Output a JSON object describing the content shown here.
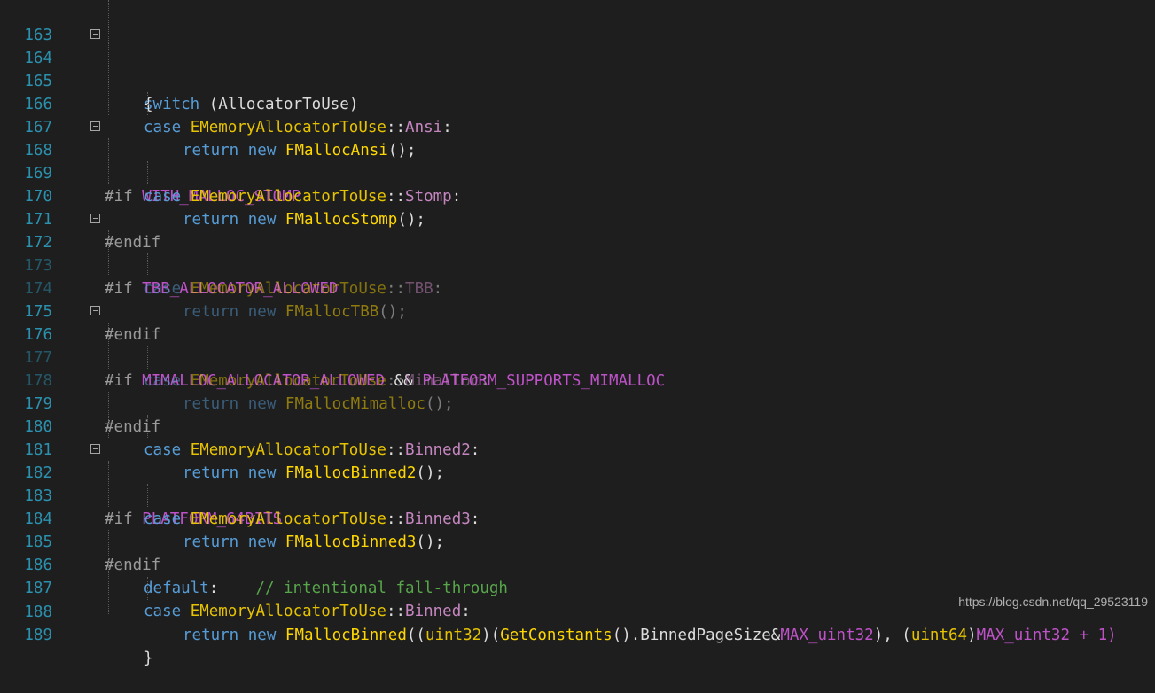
{
  "colors": {
    "background": "#1e1e1e",
    "line_number": "#2b91af",
    "keyword": "#569cd6",
    "class_name": "#e6c300",
    "enum_member": "#c586c0",
    "function": "#ffd700",
    "preprocessor": "#9b9b9b",
    "macro": "#be52c8",
    "comment": "#57a64a"
  },
  "lines": [
    {
      "n": "163",
      "tokens": []
    },
    {
      "n": "164",
      "tokens": [
        {
          "t": "switch",
          "c": "kw"
        },
        {
          "t": " (",
          "c": "plain"
        },
        {
          "t": "AllocatorToUse",
          "c": "plain"
        },
        {
          "t": ")",
          "c": "plain"
        }
      ]
    },
    {
      "n": "165",
      "tokens": [
        {
          "t": "{",
          "c": "plain"
        }
      ]
    },
    {
      "n": "166",
      "tokens": [
        {
          "t": "case ",
          "c": "kw"
        },
        {
          "t": "EMemoryAllocatorToUse",
          "c": "cls"
        },
        {
          "t": "::",
          "c": "plain"
        },
        {
          "t": "Ansi",
          "c": "enum"
        },
        {
          "t": ":",
          "c": "plain"
        }
      ]
    },
    {
      "n": "167",
      "tokens": [
        {
          "t": "return new ",
          "c": "kw"
        },
        {
          "t": "FMallocAnsi",
          "c": "fn"
        },
        {
          "t": "();",
          "c": "plain"
        }
      ]
    },
    {
      "n": "168",
      "tokens": [
        {
          "t": "#if ",
          "c": "pp"
        },
        {
          "t": "WITH_MALLOC_STOMP",
          "c": "macro"
        }
      ]
    },
    {
      "n": "169",
      "tokens": [
        {
          "t": "case ",
          "c": "kw"
        },
        {
          "t": "EMemoryAllocatorToUse",
          "c": "cls"
        },
        {
          "t": "::",
          "c": "plain"
        },
        {
          "t": "Stomp",
          "c": "enum"
        },
        {
          "t": ":",
          "c": "plain"
        }
      ]
    },
    {
      "n": "170",
      "tokens": [
        {
          "t": "return new ",
          "c": "kw"
        },
        {
          "t": "FMallocStomp",
          "c": "fn"
        },
        {
          "t": "();",
          "c": "plain"
        }
      ]
    },
    {
      "n": "171",
      "tokens": [
        {
          "t": "#endif",
          "c": "pp"
        }
      ]
    },
    {
      "n": "172",
      "tokens": [
        {
          "t": "#if ",
          "c": "pp"
        },
        {
          "t": "TBB_ALLOCATOR_ALLOWED",
          "c": "macro"
        }
      ]
    },
    {
      "n": "173",
      "tokens": [
        {
          "t": "case ",
          "c": "kw"
        },
        {
          "t": "EMemoryAllocatorToUse",
          "c": "cls"
        },
        {
          "t": "::",
          "c": "plain"
        },
        {
          "t": "TBB",
          "c": "enum"
        },
        {
          "t": ":",
          "c": "plain"
        }
      ]
    },
    {
      "n": "174",
      "tokens": [
        {
          "t": "return new ",
          "c": "kw"
        },
        {
          "t": "FMallocTBB",
          "c": "fn"
        },
        {
          "t": "();",
          "c": "plain"
        }
      ]
    },
    {
      "n": "175",
      "tokens": [
        {
          "t": "#endif",
          "c": "pp"
        }
      ]
    },
    {
      "n": "176",
      "tokens": [
        {
          "t": "#if ",
          "c": "pp"
        },
        {
          "t": "MIMALLOC_ALLOCATOR_ALLOWED",
          "c": "macro"
        },
        {
          "t": " && ",
          "c": "plain"
        },
        {
          "t": "PLATFORM_SUPPORTS_MIMALLOC",
          "c": "macro"
        }
      ]
    },
    {
      "n": "177",
      "tokens": [
        {
          "t": "case ",
          "c": "kw"
        },
        {
          "t": "EMemoryAllocatorToUse",
          "c": "cls"
        },
        {
          "t": "::",
          "c": "plain"
        },
        {
          "t": "Mimalloc",
          "c": "enum"
        },
        {
          "t": ":",
          "c": "plain"
        }
      ]
    },
    {
      "n": "178",
      "tokens": [
        {
          "t": "return new ",
          "c": "kw"
        },
        {
          "t": "FMallocMimalloc",
          "c": "fn"
        },
        {
          "t": "();",
          "c": "plain"
        }
      ]
    },
    {
      "n": "179",
      "tokens": [
        {
          "t": "#endif",
          "c": "pp"
        }
      ]
    },
    {
      "n": "180",
      "tokens": [
        {
          "t": "case ",
          "c": "kw"
        },
        {
          "t": "EMemoryAllocatorToUse",
          "c": "cls"
        },
        {
          "t": "::",
          "c": "plain"
        },
        {
          "t": "Binned2",
          "c": "enum"
        },
        {
          "t": ":",
          "c": "plain"
        }
      ]
    },
    {
      "n": "181",
      "tokens": [
        {
          "t": "return new ",
          "c": "kw"
        },
        {
          "t": "FMallocBinned2",
          "c": "fn"
        },
        {
          "t": "();",
          "c": "plain"
        }
      ]
    },
    {
      "n": "182",
      "tokens": [
        {
          "t": "#if ",
          "c": "pp"
        },
        {
          "t": "PLATFORM_64BITS",
          "c": "macro"
        }
      ]
    },
    {
      "n": "183",
      "tokens": [
        {
          "t": "case ",
          "c": "kw"
        },
        {
          "t": "EMemoryAllocatorToUse",
          "c": "cls"
        },
        {
          "t": "::",
          "c": "plain"
        },
        {
          "t": "Binned3",
          "c": "enum"
        },
        {
          "t": ":",
          "c": "plain"
        }
      ]
    },
    {
      "n": "184",
      "tokens": [
        {
          "t": "return new ",
          "c": "kw"
        },
        {
          "t": "FMallocBinned3",
          "c": "fn"
        },
        {
          "t": "();",
          "c": "plain"
        }
      ]
    },
    {
      "n": "185",
      "tokens": [
        {
          "t": "#endif",
          "c": "pp"
        }
      ]
    },
    {
      "n": "186",
      "tokens": [
        {
          "t": "default",
          "c": "kw"
        },
        {
          "t": ":    ",
          "c": "plain"
        },
        {
          "t": "// intentional fall-through",
          "c": "cmt"
        }
      ]
    },
    {
      "n": "187",
      "tokens": [
        {
          "t": "case ",
          "c": "kw"
        },
        {
          "t": "EMemoryAllocatorToUse",
          "c": "cls"
        },
        {
          "t": "::",
          "c": "plain"
        },
        {
          "t": "Binned",
          "c": "enum"
        },
        {
          "t": ":",
          "c": "plain"
        }
      ]
    },
    {
      "n": "188",
      "tokens": [
        {
          "t": "return new ",
          "c": "kw"
        },
        {
          "t": "FMallocBinned",
          "c": "fn"
        },
        {
          "t": "((",
          "c": "plain"
        },
        {
          "t": "uint32",
          "c": "cls"
        },
        {
          "t": ")(",
          "c": "plain"
        },
        {
          "t": "GetConstants",
          "c": "fn"
        },
        {
          "t": "().BinnedPageSize&",
          "c": "plain"
        },
        {
          "t": "MAX_uint32",
          "c": "macro"
        },
        {
          "t": "), (",
          "c": "plain"
        },
        {
          "t": "uint64",
          "c": "cls"
        },
        {
          "t": ")",
          "c": "plain"
        },
        {
          "t": "MAX_uint32 + 1)",
          "c": "macro"
        }
      ]
    },
    {
      "n": "189",
      "tokens": [
        {
          "t": "}",
          "c": "plain"
        }
      ]
    }
  ],
  "watermark": "https://blog.csdn.net/qq_29523119"
}
